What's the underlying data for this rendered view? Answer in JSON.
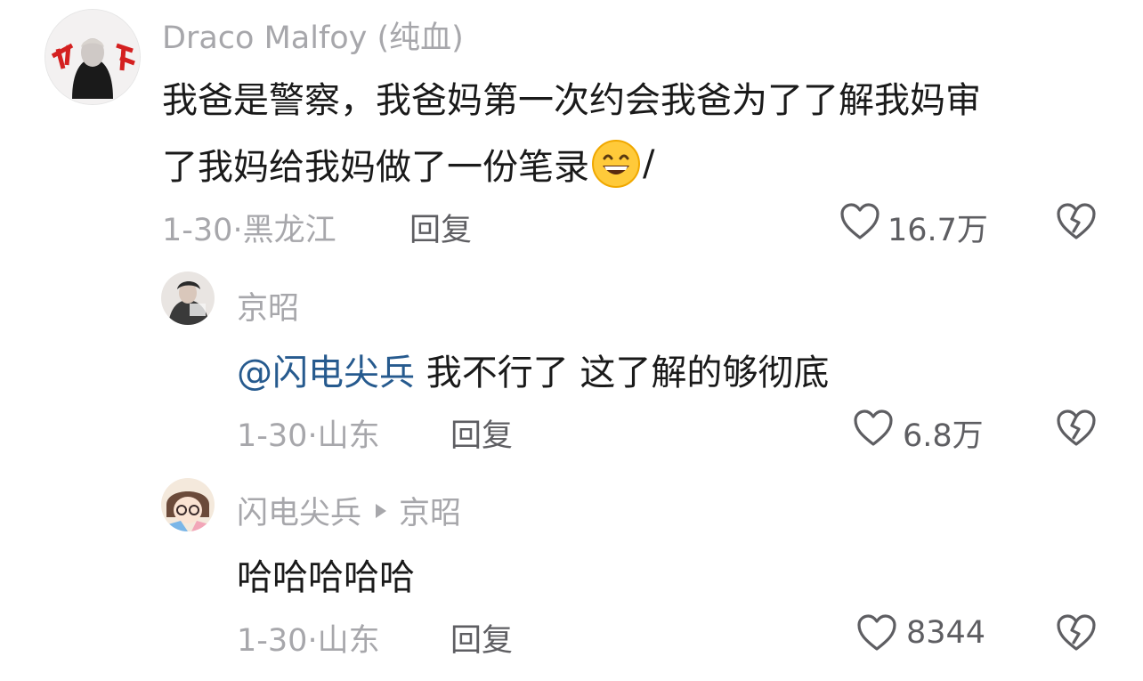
{
  "comments": [
    {
      "author": "Draco  Malfoy (纯血)",
      "text": "我爸是警察，我爸妈第一次约会我爸为了了解我妈审",
      "text2": "了我妈给我妈做了一份笔录",
      "text2_suffix": "/",
      "date": "1-30",
      "dot": "·",
      "location": "黑龙江",
      "reply_label": "回复",
      "likes": "16.7万"
    },
    {
      "author": "京昭",
      "mention": "@闪电尖兵",
      "text": " 我不行了 这了解的够彻底",
      "date": "1-30",
      "dot": "·",
      "location": "山东",
      "reply_label": "回复",
      "likes": "6.8万"
    },
    {
      "author": "闪电尖兵",
      "reply_to": "京昭",
      "text": "哈哈哈哈哈",
      "date": "1-30",
      "dot": "·",
      "location": "山东",
      "reply_label": "回复",
      "likes": "8344"
    }
  ],
  "icons": {
    "like": "heart-outline-icon",
    "dislike": "broken-heart-icon",
    "emoji": "grinning-face-emoji",
    "reply_arrow": "play-triangle-icon"
  },
  "colors": {
    "mention": "#265a8e",
    "muted": "#a7a7ab"
  }
}
